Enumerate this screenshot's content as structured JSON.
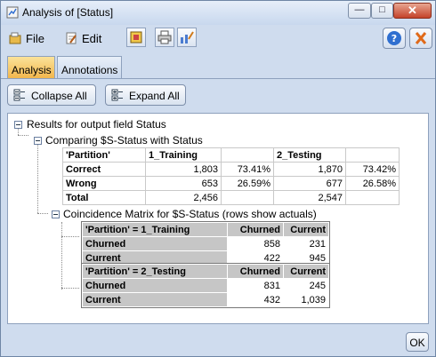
{
  "window": {
    "title": "Analysis of [Status]"
  },
  "menu": {
    "file": "File",
    "edit": "Edit"
  },
  "tabs": [
    "Analysis",
    "Annotations"
  ],
  "actions": {
    "collapse_all": "Collapse All",
    "expand_all": "Expand All"
  },
  "tree": {
    "root": "Results for output field Status",
    "comparing": "Comparing $S-Status with Status",
    "coincidence": "Coincidence Matrix for $S-Status (rows show actuals)"
  },
  "comparison_table": {
    "header": [
      "'Partition'",
      "1_Training",
      "",
      "2_Testing",
      ""
    ],
    "rows": [
      [
        "Correct",
        "1,803",
        "73.41%",
        "1,870",
        "73.42%"
      ],
      [
        "Wrong",
        "653",
        "26.59%",
        "677",
        "26.58%"
      ],
      [
        "Total",
        "2,456",
        "",
        "2,547",
        ""
      ]
    ]
  },
  "matrix_training": {
    "header": [
      "'Partition' = 1_Training",
      "Churned",
      "Current"
    ],
    "rows": [
      [
        "Churned",
        "858",
        "231"
      ],
      [
        "Current",
        "422",
        "945"
      ]
    ]
  },
  "matrix_testing": {
    "header": [
      "'Partition' = 2_Testing",
      "Churned",
      "Current"
    ],
    "rows": [
      [
        "Churned",
        "831",
        "245"
      ],
      [
        "Current",
        "432",
        "1,039"
      ]
    ]
  },
  "footer": {
    "ok": "OK"
  },
  "colors": {
    "window_bg": "#cfdcee",
    "active_tab": "#f2b64c",
    "matrix_header": "#c6c6c6"
  }
}
